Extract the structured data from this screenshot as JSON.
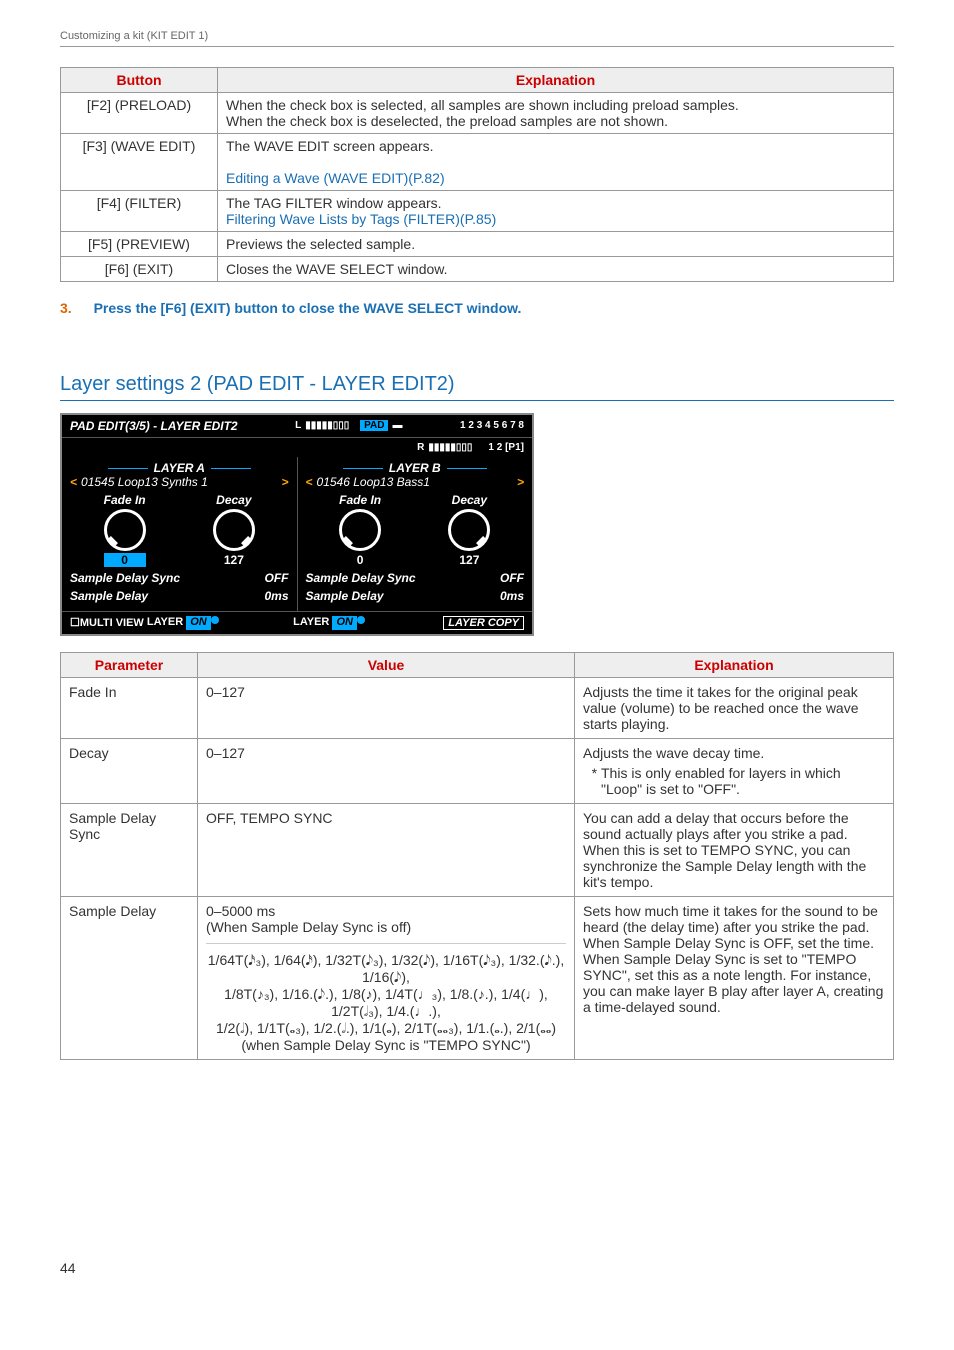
{
  "header": "Customizing a kit (KIT EDIT 1)",
  "page_number": "44",
  "buttons_table": {
    "headers": [
      "Button",
      "Explanation"
    ],
    "rows": [
      {
        "button": "[F2] (PRELOAD)",
        "explanation_lines": [
          "When the check box is selected, all samples are shown including preload samples.",
          "When the check box is deselected, the preload samples are not shown."
        ]
      },
      {
        "button": "[F3] (WAVE EDIT)",
        "explanation_lines": [
          "The WAVE EDIT screen appears."
        ],
        "link_text": "Editing a Wave (WAVE EDIT)(P.82)"
      },
      {
        "button": "[F4] (FILTER)",
        "explanation_lines": [
          "The TAG FILTER window appears."
        ],
        "link_text": "Filtering Wave Lists by Tags (FILTER)(P.85)"
      },
      {
        "button": "[F5] (PREVIEW)",
        "explanation_lines": [
          "Previews the selected sample."
        ]
      },
      {
        "button": "[F6] (EXIT)",
        "explanation_lines": [
          "Closes the WAVE SELECT window."
        ]
      }
    ]
  },
  "step": {
    "num": "3.",
    "text": "Press the [F6] (EXIT) button to close the WAVE SELECT window."
  },
  "section_heading": "Layer settings 2 (PAD EDIT - LAYER EDIT2)",
  "lcd": {
    "title": "PAD EDIT(3/5) - LAYER EDIT2",
    "meters_l": "L",
    "meters_r": "R",
    "pad": "PAD",
    "grid_top": "1 2 3 4 5 6 7 8",
    "grid_bot": "1 2 [P1]",
    "layer_a": {
      "name": "LAYER A",
      "wave": "01545 Loop13 Synths 1",
      "fade_label": "Fade In",
      "fade_value": "0",
      "decay_label": "Decay",
      "decay_value": "127",
      "sds_label": "Sample Delay Sync",
      "sds_value": "OFF",
      "sd_label": "Sample Delay",
      "sd_value": "0ms"
    },
    "layer_b": {
      "name": "LAYER B",
      "wave": "01546 Loop13 Bass1",
      "fade_label": "Fade In",
      "fade_value": "0",
      "decay_label": "Decay",
      "decay_value": "127",
      "sds_label": "Sample Delay Sync",
      "sds_value": "OFF",
      "sd_label": "Sample Delay",
      "sd_value": "0ms"
    },
    "footer": {
      "multi": "☐MULTI VIEW",
      "layer_a_label": "LAYER",
      "layer_a_toggle": "ON",
      "layer_b_label": "LAYER",
      "layer_b_toggle": "ON",
      "copy": "LAYER COPY"
    }
  },
  "param_table": {
    "headers": [
      "Parameter",
      "Value",
      "Explanation"
    ],
    "rows": [
      {
        "param": "Fade In",
        "value": "0–127",
        "explanation": "Adjusts the time it takes for the original peak value (volume) to be reached once the wave starts playing."
      },
      {
        "param": "Decay",
        "value": "0–127",
        "explanation": "Adjusts the wave decay time.",
        "note": "This is only enabled for layers in which \"Loop\" is set to \"OFF\"."
      },
      {
        "param": "Sample Delay Sync",
        "value": "OFF, TEMPO SYNC",
        "explanation": "You can add a delay that occurs before the sound actually plays after you strike a pad.\nWhen this is set to TEMPO SYNC, you can synchronize the Sample Delay length with the kit's tempo."
      },
      {
        "param": "Sample Delay",
        "value_top": "0–5000 ms\n(When Sample Delay Sync is off)",
        "value_bottom_lines": [
          "1/64T(𝅘𝅥𝅯₃), 1/64(𝅘𝅥𝅯), 1/32T(𝅘𝅥𝅮₃), 1/32(𝅘𝅥𝅮), 1/16T(𝅘𝅥𝅮₃), 1/32.(𝅘𝅥𝅮.), 1/16(𝅘𝅥𝅮),",
          "1/8T(♪₃), 1/16.(𝅘𝅥𝅮.), 1/8(♪), 1/4T(♩₃), 1/8.(♪.), 1/4(♩), 1/2T(𝅗𝅥₃), 1/4.(♩.),",
          "1/2(𝅗𝅥), 1/1T(𝅝₃), 1/2.(𝅗𝅥.), 1/1(𝅝), 2/1T(𝅝𝅝₃), 1/1.(𝅝.), 2/1(𝅝𝅝)",
          "(when Sample Delay Sync is \"TEMPO SYNC\")"
        ],
        "explanation": "Sets how much time it takes for the sound to be heard (the delay time) after you strike the pad.\nWhen Sample Delay Sync is OFF, set the time.\nWhen Sample Delay Sync is set to \"TEMPO SYNC\", set this as a note length. For instance, you can make layer B play after layer A, creating a time-delayed sound."
      }
    ]
  }
}
